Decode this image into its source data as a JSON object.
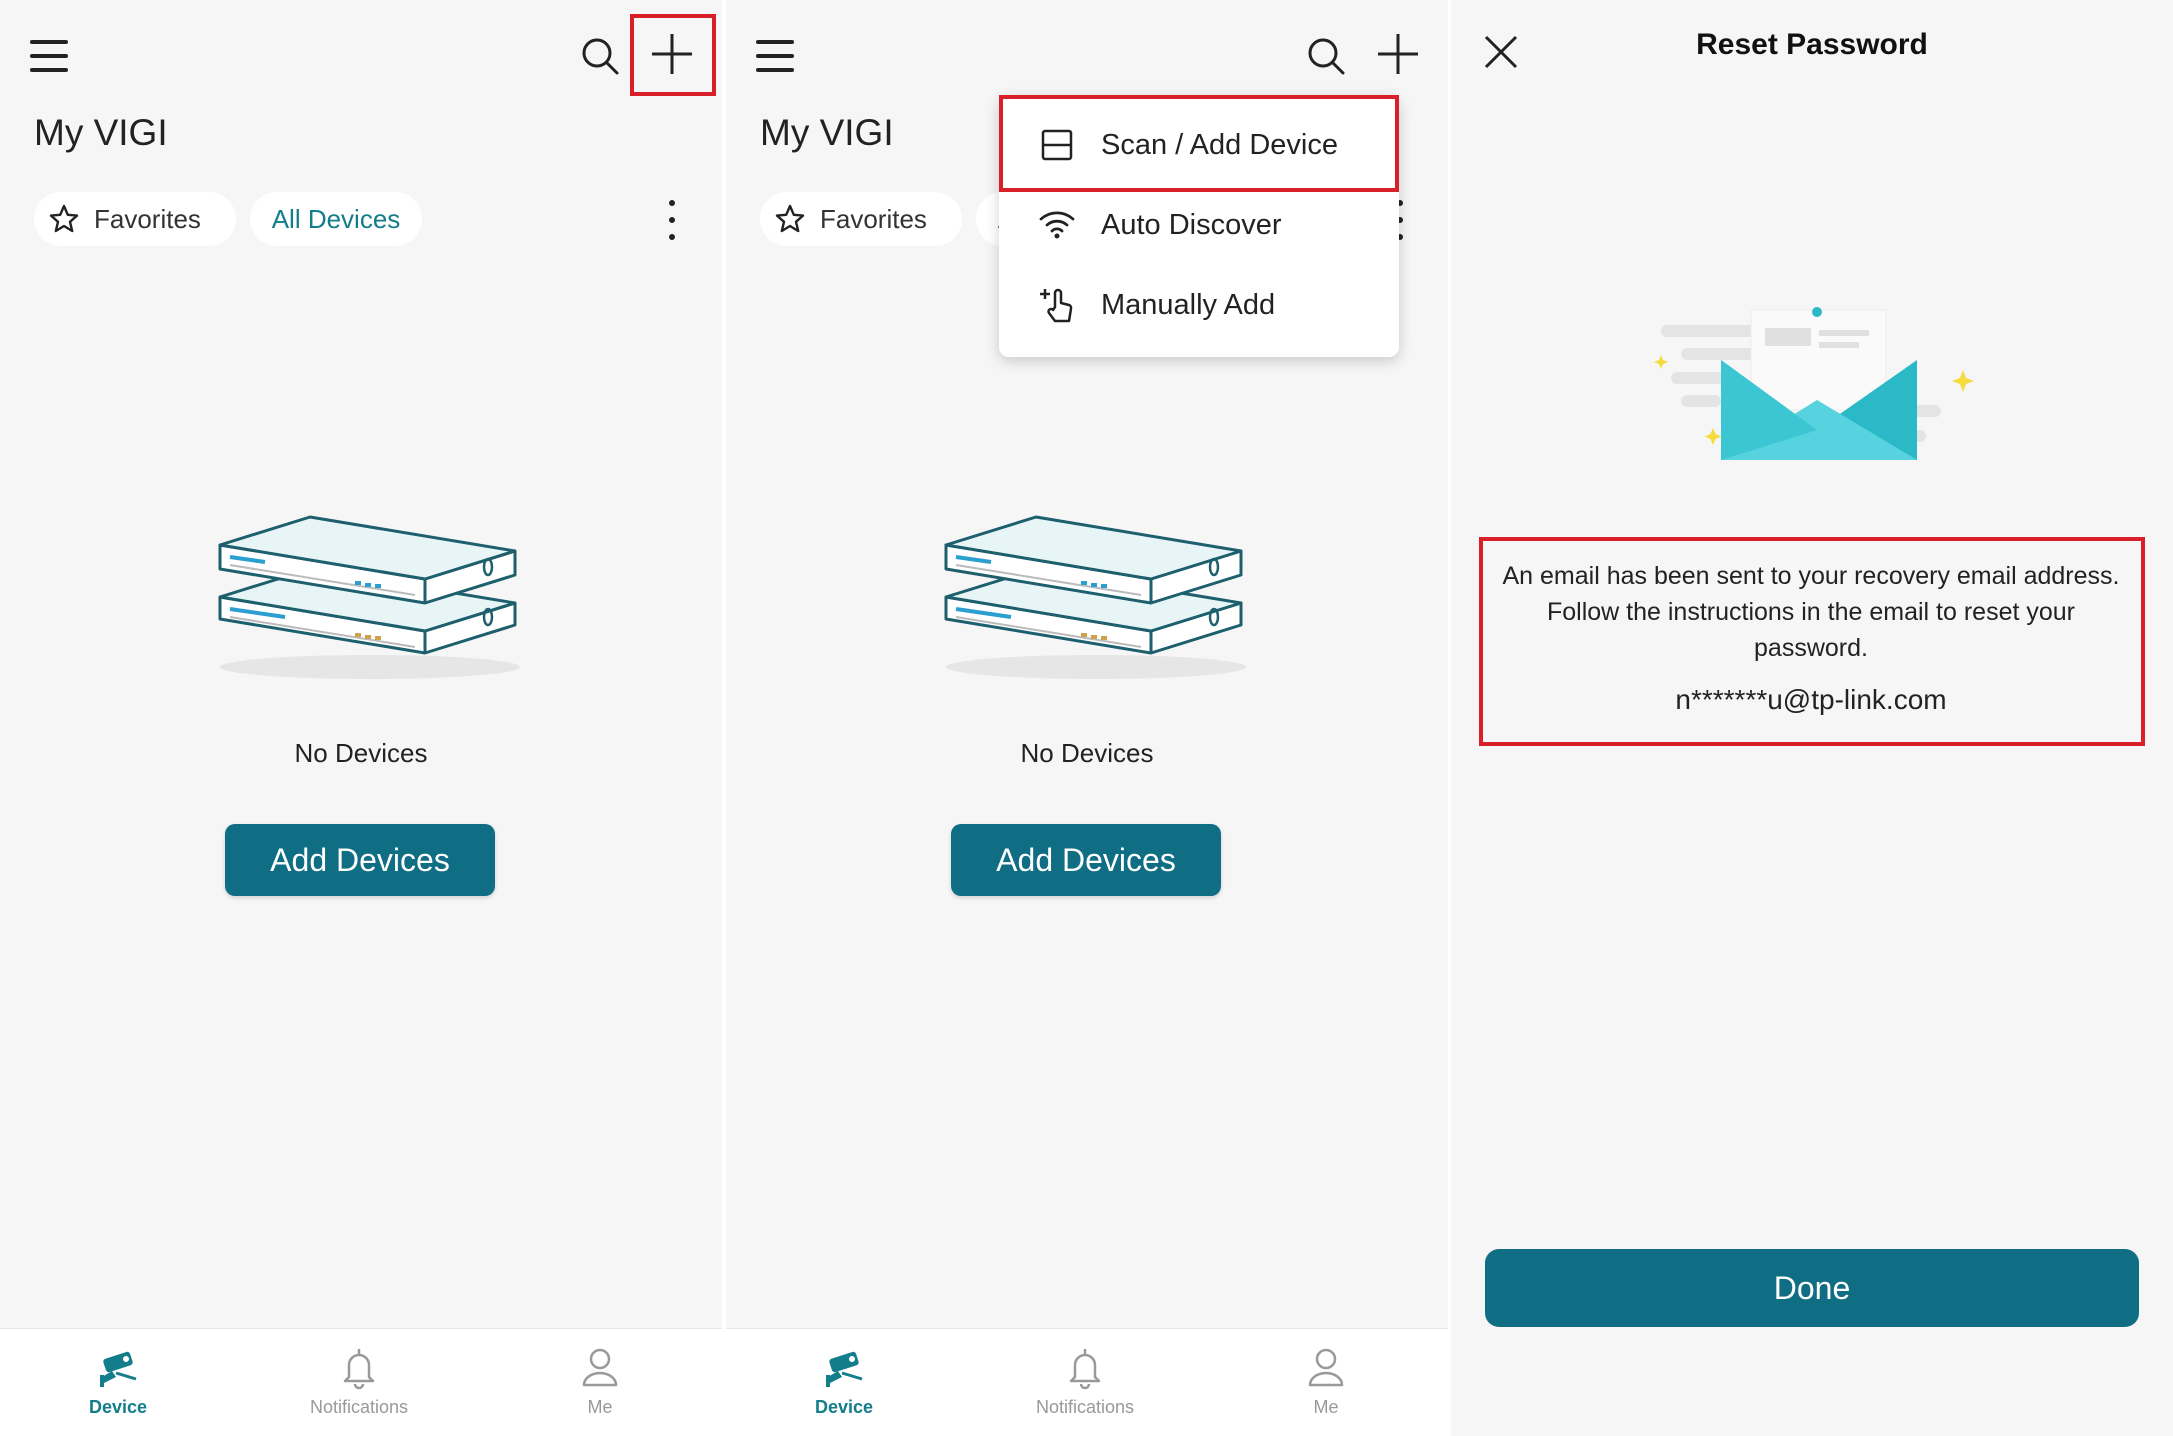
{
  "screens": {
    "home": {
      "title": "My VIGI",
      "filters": {
        "favorites": "Favorites",
        "all_devices": "All Devices"
      },
      "empty_text": "No Devices",
      "add_button": "Add Devices"
    },
    "menu": {
      "items": [
        {
          "label": "Scan / Add Device",
          "icon": "scan-icon"
        },
        {
          "label": "Auto Discover",
          "icon": "wifi-icon"
        },
        {
          "label": "Manually Add",
          "icon": "hand-plus-icon"
        }
      ]
    },
    "reset": {
      "title": "Reset Password",
      "message": "An email has been sent to your recovery email address. Follow the instructions in the email to reset your password.",
      "email": "n*******u@tp-link.com",
      "done_button": "Done"
    }
  },
  "tabbar": {
    "items": [
      {
        "label": "Device",
        "icon": "camera-icon",
        "active": true
      },
      {
        "label": "Notifications",
        "icon": "bell-icon",
        "active": false
      },
      {
        "label": "Me",
        "icon": "person-icon",
        "active": false
      }
    ]
  },
  "colors": {
    "accent": "#0f6d84",
    "accent_text": "#137d8c",
    "highlight": "#d9202a",
    "background": "#f6f6f6"
  }
}
